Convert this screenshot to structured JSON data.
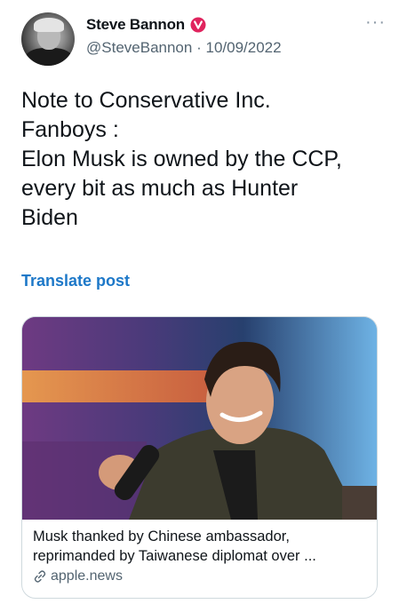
{
  "author": {
    "name": "Steve Bannon",
    "handle": "@SteveBannon",
    "separator": "·",
    "date": "10/09/2022",
    "badge_color": "#e0245e"
  },
  "more_menu": "···",
  "tweet": {
    "text": "Note to Conservative Inc.\nFanboys :\nElon Musk is owned by the CCP,\nevery bit as much as Hunter\nBiden"
  },
  "translate_label": "Translate post",
  "card": {
    "title": "Musk thanked by Chinese ambassador, reprimanded by Taiwanese diplomat over ...",
    "domain": "apple.news",
    "link_icon": "link-icon"
  },
  "icons": {
    "badge": "verified-badge-icon",
    "more": "more-options-icon"
  },
  "colors": {
    "link": "#1d78c8",
    "secondary_text": "#536471"
  }
}
